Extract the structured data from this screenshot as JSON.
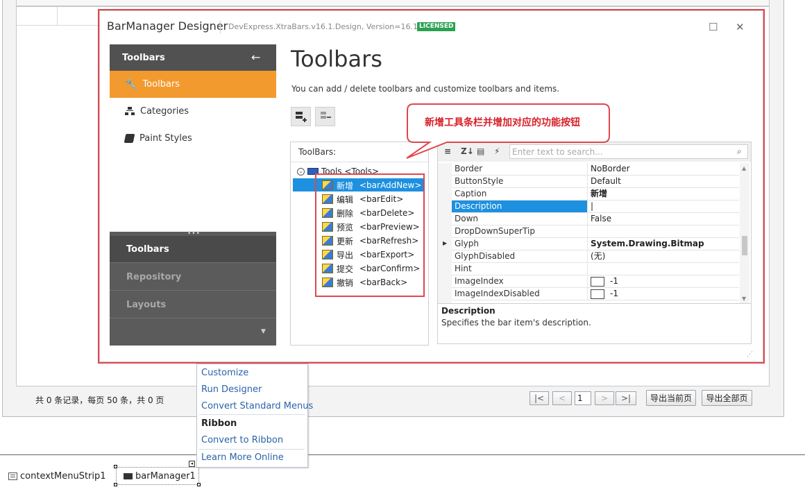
{
  "host": {
    "pager_info": "共 0 条记录，每页 50 条，共 0 页",
    "pager": {
      "first": "|<",
      "prev": "<",
      "page": "1",
      "next": ">",
      "last": ">|"
    },
    "export_current": "导出当前页",
    "export_all": "导出全部页"
  },
  "designer": {
    "title": "BarManager Designer",
    "version": "DevExpress.XtraBars.v16.1.Design, Version=16.1.6.0",
    "badge": "LICENSED",
    "nav": {
      "header": "Toolbars",
      "items": [
        {
          "label": "Toolbars",
          "icon": "wrench-icon",
          "active": true
        },
        {
          "label": "Categories",
          "icon": "hierarchy-icon",
          "active": false
        },
        {
          "label": "Paint Styles",
          "icon": "paint-bucket-icon",
          "active": false
        }
      ],
      "groups": [
        {
          "label": "Toolbars",
          "active": true
        },
        {
          "label": "Repository",
          "active": false
        },
        {
          "label": "Layouts",
          "active": false
        }
      ]
    },
    "main": {
      "title": "Toolbars",
      "description": "You can add / delete toolbars and customize toolbars and items."
    },
    "tree": {
      "label": "ToolBars:",
      "root": "Tools  <Tools>",
      "items": [
        {
          "name": "新增",
          "id": "<barAddNew>"
        },
        {
          "name": "编辑",
          "id": "<barEdit>"
        },
        {
          "name": "删除",
          "id": "<barDelete>"
        },
        {
          "name": "预览",
          "id": "<barPreview>"
        },
        {
          "name": "更新",
          "id": "<barRefresh>"
        },
        {
          "name": "导出",
          "id": "<barExport>"
        },
        {
          "name": "提交",
          "id": "<barConfirm>"
        },
        {
          "name": "撤销",
          "id": "<barBack>"
        }
      ]
    },
    "props": {
      "search_placeholder": "Enter text to search...",
      "rows": [
        {
          "name": "Border",
          "value": "NoBorder"
        },
        {
          "name": "ButtonStyle",
          "value": "Default"
        },
        {
          "name": "Caption",
          "value": "新增"
        },
        {
          "name": "Description",
          "value": "|"
        },
        {
          "name": "Down",
          "value": "False"
        },
        {
          "name": "DropDownSuperTip",
          "value": ""
        },
        {
          "name": "Glyph",
          "value": "System.Drawing.Bitmap"
        },
        {
          "name": "GlyphDisabled",
          "value": "(无)"
        },
        {
          "name": "Hint",
          "value": ""
        },
        {
          "name": "ImageIndex",
          "value": "-1"
        },
        {
          "name": "ImageIndexDisabled",
          "value": "-1"
        }
      ],
      "desc_title": "Description",
      "desc_text": "Specifies the bar item's description."
    },
    "callout": "新增工具条栏并增加对应的功能按钮"
  },
  "tag_menu": {
    "items": [
      "Customize",
      "Run Designer",
      "Convert Standard Menus"
    ],
    "section": "Ribbon",
    "ribbon_items": [
      "Convert to Ribbon"
    ],
    "footer": "Learn More Online"
  },
  "tray": {
    "context_menu": "contextMenuStrip1",
    "bar_manager": "barManager1"
  },
  "colors": {
    "accent_orange": "#f29a2e",
    "selection_blue": "#1e90e0",
    "highlight_red": "#e0464d",
    "nav_dark": "#515151",
    "license_green": "#2aa152"
  }
}
